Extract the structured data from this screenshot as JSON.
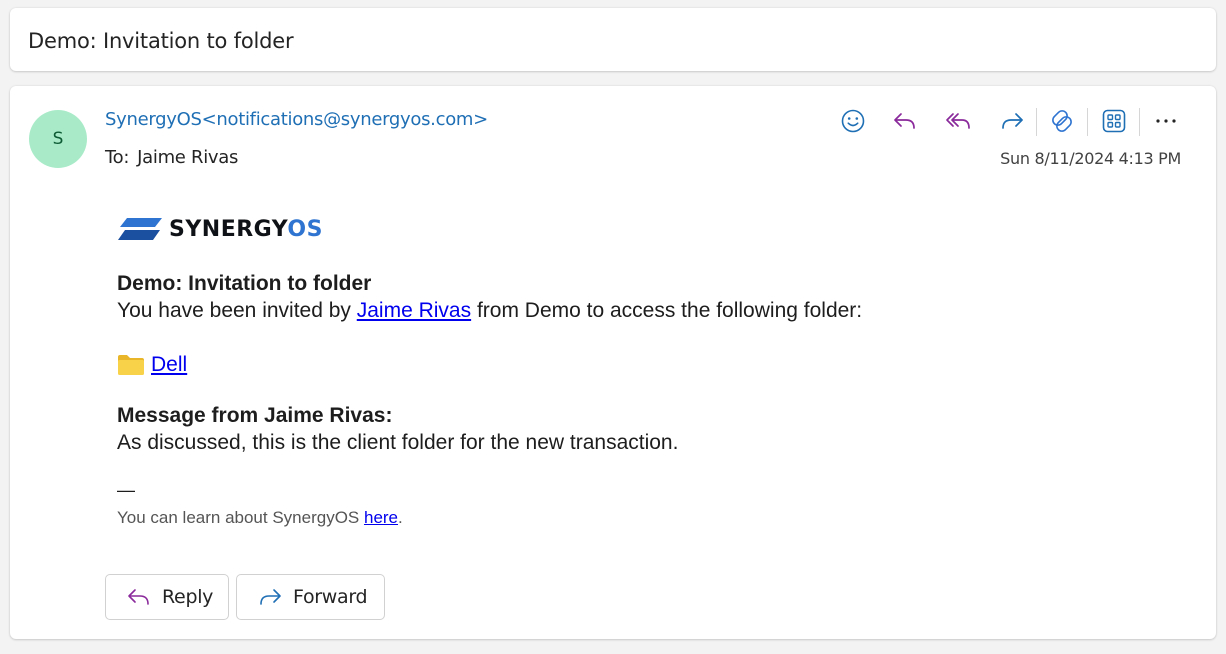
{
  "subject": "Demo: Invitation to folder",
  "header": {
    "avatar_initial": "S",
    "sender_name": "SynergyOS",
    "sender_email": "<notifications@synergyos.com>",
    "to_label": "To:",
    "to_name": "Jaime Rivas",
    "date": "Sun 8/11/2024 4:13 PM"
  },
  "toolbar": {
    "icons": [
      "emoji-icon",
      "reply-icon",
      "reply-all-icon",
      "forward-icon",
      "copilot-icon",
      "apps-icon",
      "more-icon"
    ]
  },
  "body": {
    "logo_main": "SYNERGY",
    "logo_os": "OS",
    "title": "Demo: Invitation to folder",
    "invite_prefix": "You have been invited by ",
    "invite_link": "Jaime Rivas",
    "invite_suffix": " from Demo to access the following folder:",
    "folder_name": "Dell",
    "message_title": "Message from Jaime Rivas:",
    "message_text": "As discussed, this is the client folder for the new transaction.",
    "dash": "—",
    "learn_prefix": "You can learn about SynergyOS ",
    "learn_link": "here",
    "learn_suffix": "."
  },
  "actions": {
    "reply_label": "Reply",
    "forward_label": "Forward"
  },
  "colors": {
    "sender": "#1f6fb5",
    "reply_purple": "#8a2a9b",
    "forward_blue": "#1f6fb5",
    "avatar_bg": "#a9ebc9",
    "link": "#0000ee"
  }
}
